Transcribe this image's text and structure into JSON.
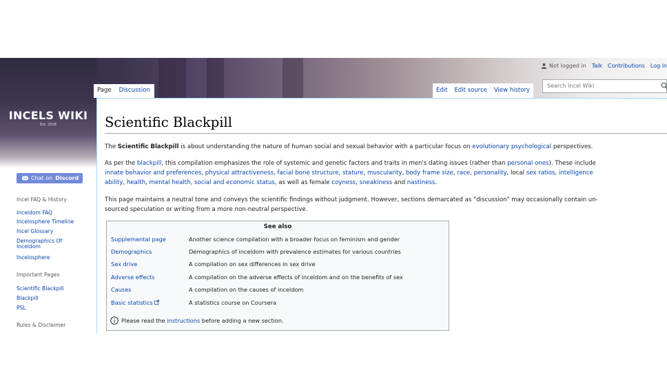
{
  "header": {
    "logo_title": "INCELS WIKI",
    "logo_subtitle": "Est. 2018",
    "personal": [
      "Not logged in",
      "Talk",
      "Contributions",
      "Log in"
    ],
    "tabs_left": [
      "Page",
      "Discussion"
    ],
    "tabs_right": [
      "Edit",
      "Edit source",
      "View history"
    ],
    "search_placeholder": "Search Incel Wiki"
  },
  "sidebar": {
    "discord_prefix": "Chat on",
    "discord_label": "Discord",
    "section1_heading": "Incel FAQ & History",
    "section1_items": [
      "Inceldom FAQ",
      "Incelosphere Timeline",
      "Incel Glossary",
      "Demographics Of",
      "Inceldom",
      "Incelosphere"
    ],
    "section2_heading": "Important Pages",
    "section2_items": [
      "Scientific Blackpill",
      "Blackpill",
      "PSL"
    ],
    "section3_heading": "Rules & Disclaimer"
  },
  "article": {
    "title": "Scientific Blackpill",
    "p1": {
      "t1": "The ",
      "bold": "Scientific Blackpill",
      "t2": " is about understanding the nature of human social and sexual behavior with a particular focus on ",
      "link1": "evolutionary psychological",
      "t3": " perspectives."
    },
    "p2": {
      "line1_a": "As per the ",
      "line1_link": "blackpill",
      "line1_b": ", this compilation emphasizes the role of systemic and genetic factors and traits in men's dating issues (rather than ",
      "line1_link2": "personal ones",
      "line1_c": "). These include",
      "line2_links": [
        "innate behavior and preferences",
        "physical attractiveness",
        "facial bone structure",
        "stature",
        "muscularity",
        "body frame size",
        "race",
        "personality"
      ],
      "line2_local": "local",
      "line2_links2": [
        "sex ratios",
        "intelligence"
      ],
      "line3_links": [
        "ability",
        "health",
        "mental health",
        "social and economic status"
      ],
      "line3_mid": "as well as female",
      "line3_links2": [
        "coyness",
        "sneakiness"
      ],
      "line3_and": "and",
      "line3_last": "nastiness"
    },
    "p3": {
      "line1": "This page maintains a neutral tone and conveys the scientific findings without judgment. However, sections demarcated as \"discussion\" may occasionally contain un-",
      "line2": "sourced speculation or writing from a more non-neutral perspective."
    }
  },
  "see_also": {
    "title": "See also",
    "rows": [
      {
        "label": "Supplemental page",
        "desc": "Another science compilation with a broader focus on feminism and gender"
      },
      {
        "label": "Demographics",
        "desc": "Demographics of inceldom with prevalence estimates for various countries"
      },
      {
        "label": "Sex drive",
        "desc": "A compilation on sex differences in sex drive"
      },
      {
        "label": "Adverse effects",
        "desc": "A compilation on the adverse effects of inceldom and on the benefits of sex"
      },
      {
        "label": "Causes",
        "desc": "A compilation on the causes of inceldom"
      },
      {
        "label": "Basic statistics",
        "desc": "A statistics course on Coursera"
      }
    ],
    "note_a": "Please read the ",
    "note_link": "instructions",
    "note_b": " before adding a new section."
  },
  "colors": {
    "link": "#0645ad",
    "discord": "#7289da",
    "text": "#202122"
  }
}
